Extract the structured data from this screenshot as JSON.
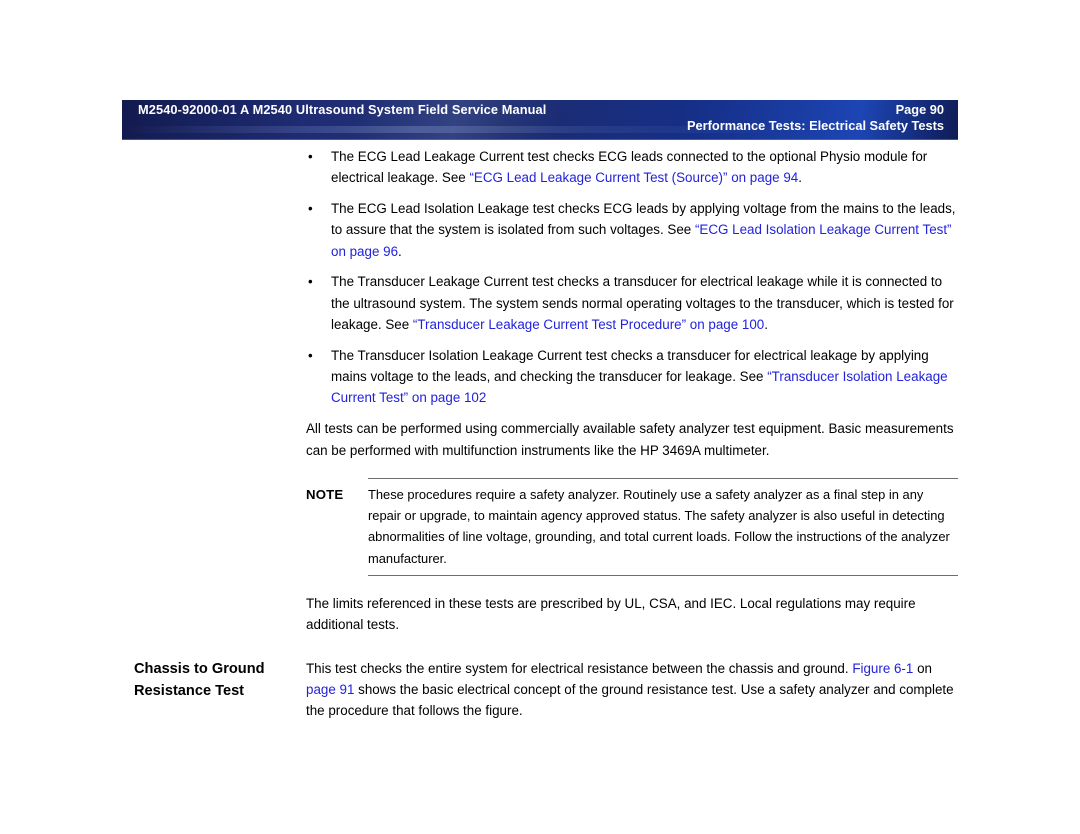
{
  "header": {
    "left_text": "M2540-92000-01 A M2540 Ultrasound System Field Service Manual",
    "page_label": "Page 90",
    "sub_text": "Performance Tests: Electrical Safety Tests",
    "band_color": "#132063",
    "band_accent": "#1d45b4",
    "text_color": "#ffffff"
  },
  "colors": {
    "link": "#2222dd",
    "body_text": "#000000",
    "rule": "#6e6e6e",
    "page_background": "#ffffff"
  },
  "bullets": [
    {
      "marker": "•",
      "segments": [
        {
          "text": "The ECG Lead Leakage Current test checks ECG leads connected to the optional Physio module for electrical leakage. See ",
          "link": false
        },
        {
          "text": "“ECG Lead Leakage Current Test (Source)” on page 94",
          "link": true
        },
        {
          "text": ".",
          "link": false
        }
      ]
    },
    {
      "marker": "•",
      "segments": [
        {
          "text": "The ECG Lead Isolation Leakage test checks ECG leads by applying voltage from the mains to the leads, to assure that the system is isolated from such voltages. See ",
          "link": false
        },
        {
          "text": "“ECG Lead Isolation Leakage Current Test” on page 96",
          "link": true
        },
        {
          "text": ".",
          "link": false
        }
      ]
    },
    {
      "marker": "•",
      "segments": [
        {
          "text": "The Transducer Leakage Current test checks a transducer for electrical leakage while it is connected to the ultrasound system. The system sends normal operating voltages to the transducer, which is tested for leakage. See ",
          "link": false
        },
        {
          "text": "“Transducer Leakage Current Test Procedure” on page 100",
          "link": true
        },
        {
          "text": ".",
          "link": false
        }
      ]
    },
    {
      "marker": "•",
      "segments": [
        {
          "text": "The Transducer Isolation Leakage Current test checks a transducer for electrical leakage by applying mains voltage to the leads, and checking the transducer for leakage. See ",
          "link": false
        },
        {
          "text": "“Transducer Isolation Leakage Current Test” on page 102",
          "link": true
        }
      ]
    }
  ],
  "paragraph_after_bullets": "All tests can be performed using commercially available safety analyzer test equipment. Basic measurements can be performed with multifunction instruments like the HP 3469A multimeter.",
  "note": {
    "label": "NOTE",
    "text": "These procedures require a safety analyzer. Routinely use a safety analyzer as a final step in any repair or upgrade, to maintain agency approved status. The safety analyzer is also useful in detecting abnormalities of line voltage, grounding, and total current loads. Follow the instructions of the analyzer manufacturer."
  },
  "paragraph_after_note": "The limits referenced in these tests are prescribed by UL, CSA, and IEC. Local regulations may require additional tests.",
  "section": {
    "heading": "Chassis to Ground Resistance Test",
    "body_segments": [
      {
        "text": "This test checks the entire system for electrical resistance between the chassis and ground. ",
        "link": false
      },
      {
        "text": "Figure 6-1",
        "link": true
      },
      {
        "text": " on ",
        "link": false
      },
      {
        "text": "page 91",
        "link": true
      },
      {
        "text": " shows the basic electrical concept of the ground resistance test. Use a safety analyzer and complete the procedure that follows the figure.",
        "link": false
      }
    ]
  }
}
